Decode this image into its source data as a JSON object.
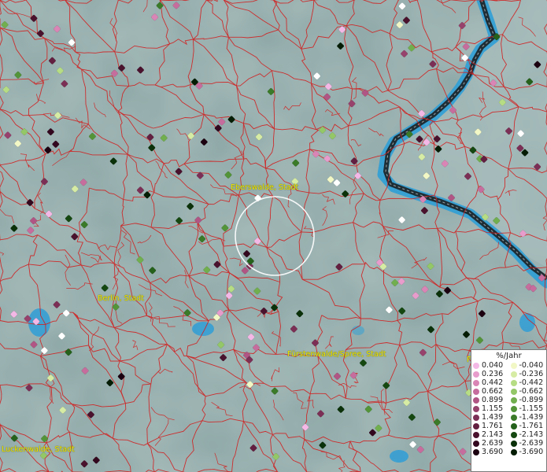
{
  "map": {
    "labels": {
      "eberswalde": "Eberswalde, Stadt",
      "berlin": "Berlin, Stadt",
      "fuerstenwalde": "Fürstenwalde/Spree, Stadt",
      "luckenwalde": "Luckenwalde, Stadt",
      "edge_f": "F"
    },
    "colors": {
      "background": "#8fa9a8",
      "district_lines": "#d21f1f",
      "border_line": "#1a1a1a",
      "water": "#2f9ed6",
      "label_text": "#f2e600",
      "focus_ring": "#ffffff"
    }
  },
  "legend": {
    "title": "%/Jahr",
    "positive": [
      {
        "value": "0.040",
        "color": "#f4b8e6"
      },
      {
        "value": "0.236",
        "color": "#e79ccc"
      },
      {
        "value": "0.442",
        "color": "#d985b5"
      },
      {
        "value": "0.662",
        "color": "#c66d9d"
      },
      {
        "value": "0.899",
        "color": "#b05584"
      },
      {
        "value": "1.155",
        "color": "#96426c"
      },
      {
        "value": "1.439",
        "color": "#7c2f55"
      },
      {
        "value": "1.761",
        "color": "#631f40"
      },
      {
        "value": "2.143",
        "color": "#4a122d"
      },
      {
        "value": "2.639",
        "color": "#33081e"
      },
      {
        "value": "3.690",
        "color": "#1c0210"
      }
    ],
    "negative": [
      {
        "value": "-0.040",
        "color": "#f2f7c6"
      },
      {
        "value": "-0.236",
        "color": "#d6eca4"
      },
      {
        "value": "-0.442",
        "color": "#b6dc84"
      },
      {
        "value": "-0.662",
        "color": "#93c767"
      },
      {
        "value": "-0.899",
        "color": "#71ae4e"
      },
      {
        "value": "-1.155",
        "color": "#539439"
      },
      {
        "value": "-1.439",
        "color": "#3a7a28"
      },
      {
        "value": "-1.761",
        "color": "#25611b"
      },
      {
        "value": "-2.143",
        "color": "#154811"
      },
      {
        "value": "-2.639",
        "color": "#0a3109"
      },
      {
        "value": "-3.690",
        "color": "#041c04"
      }
    ]
  }
}
